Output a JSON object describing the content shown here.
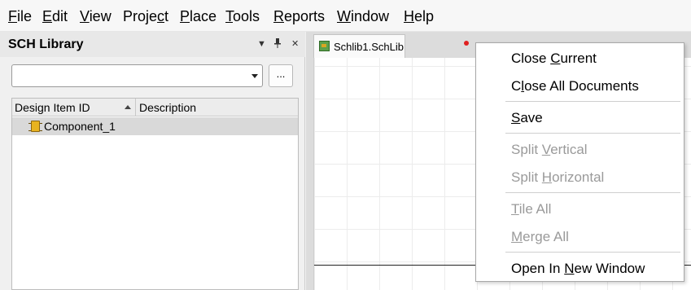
{
  "menubar": {
    "items": [
      {
        "pre": "",
        "key": "F",
        "post": "ile"
      },
      {
        "pre": "",
        "key": "E",
        "post": "dit"
      },
      {
        "pre": "",
        "key": "V",
        "post": "iew"
      },
      {
        "pre": "Proje",
        "key": "c",
        "post": "t"
      },
      {
        "pre": "",
        "key": "P",
        "post": "lace"
      },
      {
        "pre": "",
        "key": "T",
        "post": "ools"
      },
      {
        "pre": "",
        "key": "R",
        "post": "eports"
      },
      {
        "pre": "",
        "key": "W",
        "post": "indow"
      },
      {
        "pre": "",
        "key": "H",
        "post": "elp"
      }
    ]
  },
  "panel": {
    "title": "SCH Library",
    "controls": {
      "menu": "▼",
      "pin": "📌",
      "close": "✕"
    },
    "filter": {
      "value": ""
    },
    "browse_label": "...",
    "grid": {
      "columns": [
        "Design Item ID",
        "Description"
      ],
      "rows": [
        {
          "id": "Component_1",
          "description": ""
        }
      ]
    }
  },
  "document": {
    "tab_label": "Schlib1.SchLib"
  },
  "context_menu": {
    "items": [
      {
        "pre": "Close ",
        "key": "C",
        "post": "urrent",
        "disabled": false
      },
      {
        "pre": "C",
        "key": "l",
        "post": "ose All Documents",
        "disabled": false
      },
      {
        "pre": "",
        "key": "S",
        "post": "ave",
        "disabled": false
      },
      {
        "pre": "Split ",
        "key": "V",
        "post": "ertical",
        "disabled": true
      },
      {
        "pre": "Split ",
        "key": "H",
        "post": "orizontal",
        "disabled": true
      },
      {
        "pre": "",
        "key": "T",
        "post": "ile All",
        "disabled": true
      },
      {
        "pre": "",
        "key": "M",
        "post": "erge All",
        "disabled": true
      },
      {
        "pre": "Open In ",
        "key": "N",
        "post": "ew Window",
        "disabled": false
      }
    ]
  }
}
